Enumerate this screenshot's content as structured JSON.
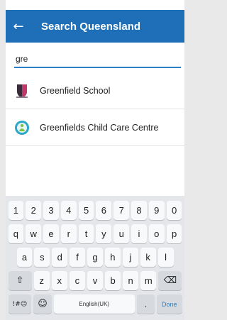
{
  "appbar": {
    "back_icon": "back-arrow-icon",
    "back_glyph": "←",
    "title": "Search Queensland",
    "color": "#1e6fb8"
  },
  "search": {
    "value": "gre",
    "underline_color": "#2b7fc6"
  },
  "results": [
    {
      "label": "Greenfield School",
      "icon": "school-crest-icon"
    },
    {
      "label": "Greenfields Child Care Centre",
      "icon": "childcare-logo-icon"
    }
  ],
  "keyboard": {
    "row_numbers": [
      "1",
      "2",
      "3",
      "4",
      "5",
      "6",
      "7",
      "8",
      "9",
      "0"
    ],
    "row_1": [
      "q",
      "w",
      "e",
      "r",
      "t",
      "y",
      "u",
      "i",
      "o",
      "p"
    ],
    "row_2": [
      "a",
      "s",
      "d",
      "f",
      "g",
      "h",
      "j",
      "k",
      "l"
    ],
    "row_3": [
      "z",
      "x",
      "c",
      "v",
      "b",
      "n",
      "m"
    ],
    "shift_glyph": "⇧",
    "backspace_glyph": "⌫",
    "symbols_label": "!#☺",
    "emoji_glyph": "☺",
    "space_label": "English(UK)",
    "period_label": ".",
    "done_label": "Done"
  }
}
